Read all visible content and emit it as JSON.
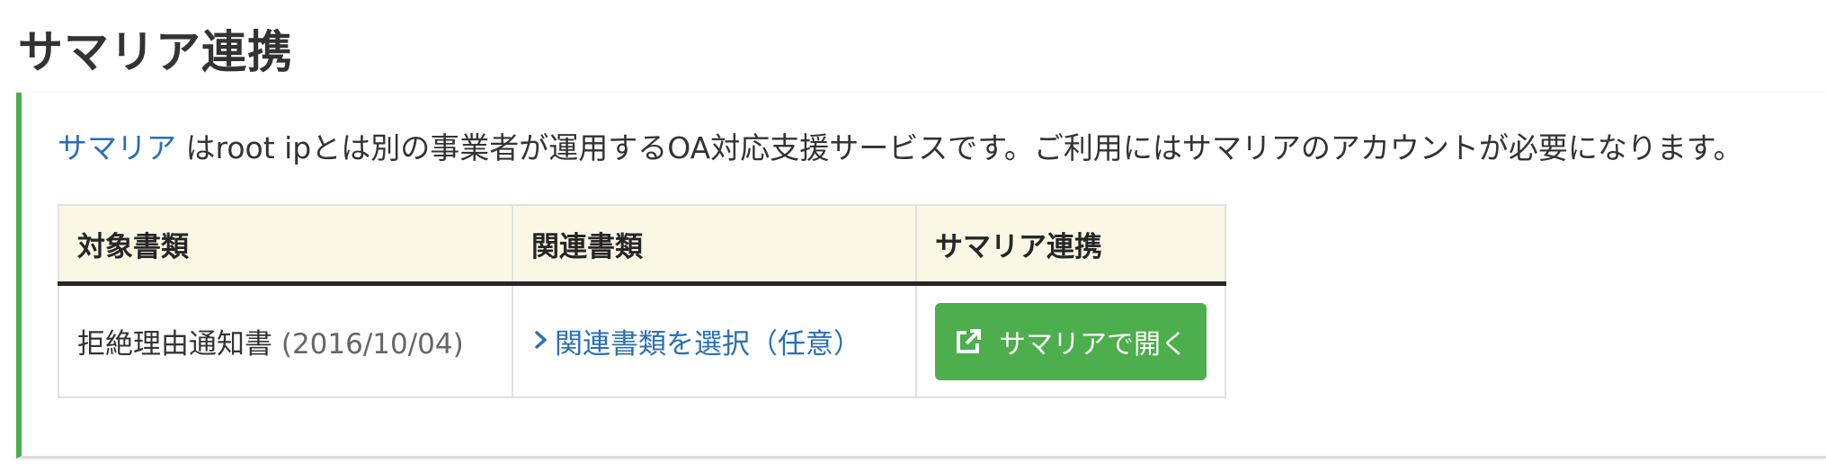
{
  "page": {
    "title": "サマリア連携"
  },
  "intro": {
    "link_label": "サマリア",
    "text": " はroot ipとは別の事業者が運用するOA対応支援サービスです。ご利用にはサマリアのアカウントが必要になります。"
  },
  "table": {
    "headers": [
      "対象書類",
      "関連書類",
      "サマリア連携"
    ],
    "rows": [
      {
        "document": "拒絶理由通知書",
        "date": "(2016/10/04)",
        "related_link": "関連書類を選択（任意）",
        "open_button": "サマリアで開く"
      }
    ]
  },
  "icons": {
    "related": "chevron-right-icon",
    "open": "external-link-icon"
  },
  "colors": {
    "accent_green": "#4cae4c",
    "link_blue": "#2a6fb5",
    "header_bg": "#fbf7e5"
  }
}
